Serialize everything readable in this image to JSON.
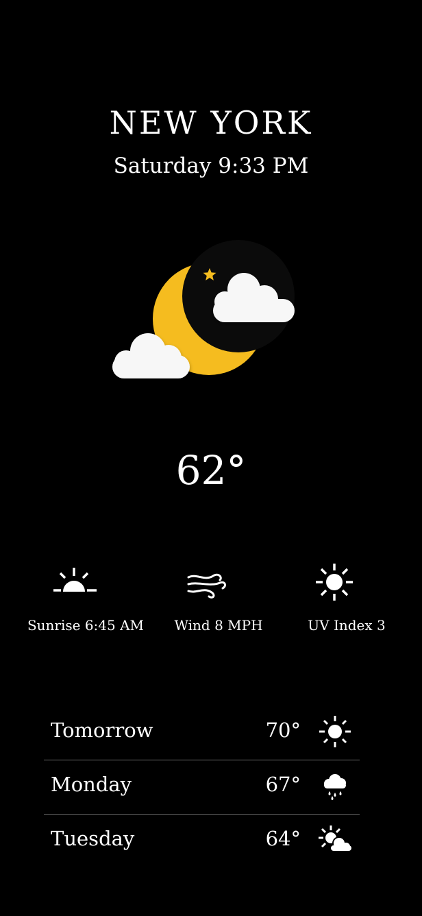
{
  "location": {
    "city": "NEW YORK",
    "datetime": "Saturday 9:33 PM"
  },
  "current": {
    "temperature": "62°",
    "condition_icon": "crescent-moon-clouds-icon",
    "colors": {
      "moon": "#F5BC1F",
      "cloud": "#FAFAFA",
      "background": "#000000"
    }
  },
  "stats": [
    {
      "icon": "sunrise-icon",
      "label": "Sunrise 6:45 AM"
    },
    {
      "icon": "wind-icon",
      "label": "Wind 8 MPH"
    },
    {
      "icon": "sun-icon",
      "label": "UV Index 3"
    }
  ],
  "forecast": [
    {
      "day": "Tomorrow",
      "high": "70°",
      "icon": "sun-icon"
    },
    {
      "day": "Monday",
      "high": "67°",
      "icon": "rain-cloud-icon"
    },
    {
      "day": "Tuesday",
      "high": "64°",
      "icon": "partly-cloudy-icon"
    }
  ]
}
